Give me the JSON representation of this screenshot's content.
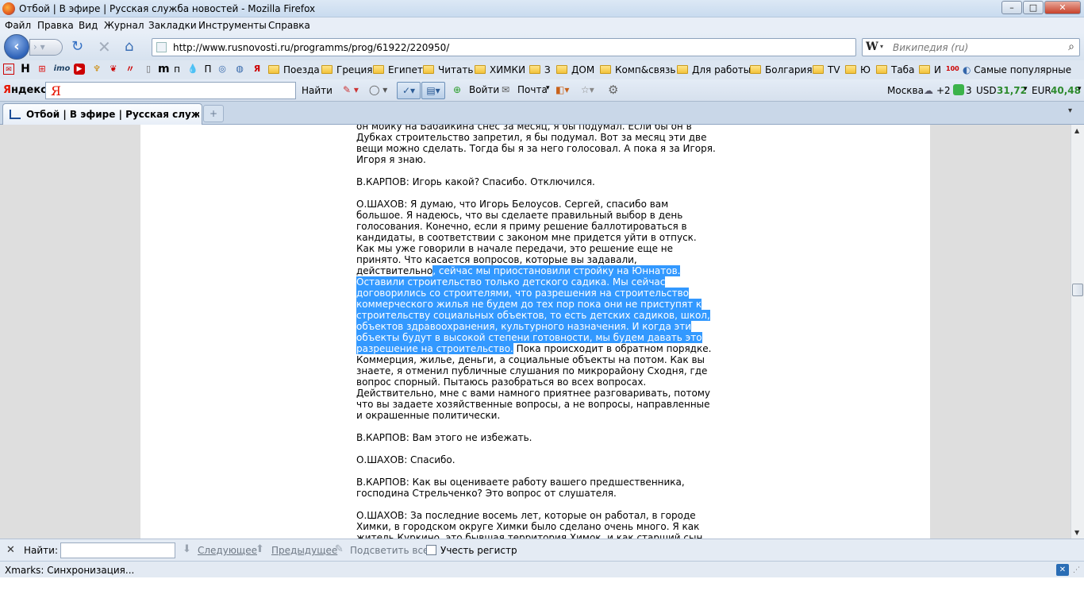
{
  "window": {
    "title": "Отбой | В эфире | Русская служба новостей - Mozilla Firefox",
    "min": "–",
    "max": "□",
    "close": "✕"
  },
  "menu": [
    "Файл",
    "Правка",
    "Вид",
    "Журнал",
    "Закладки",
    "Инструменты",
    "Справка"
  ],
  "nav": {
    "url": "http://www.rusnovosti.ru/programms/prog/61922/220950/",
    "search_placeholder": "Википедия (ru)",
    "search_engine_letter": "W"
  },
  "bookmarks": {
    "icons": [
      "H",
      "imo",
      "п",
      "П"
    ],
    "folders": [
      "Поезда",
      "Греция",
      "Египет",
      "Читать",
      "ХИМКИ",
      "З",
      "ДОМ",
      "Комп&связь",
      "Для работы",
      "Болгария",
      "TV",
      "Ю",
      "Таба",
      "И"
    ],
    "last": "Самые популярные"
  },
  "yandex": {
    "logo_red": "Я",
    "logo_rest": "ндекс",
    "input_letter": "Я",
    "find": "Найти",
    "login": "Войти",
    "mail": "Почта",
    "city": "Москва",
    "weather": "+2",
    "traffic": "3",
    "usd_label": "USD",
    "usd_value": "31,72",
    "eur_label": "EUR",
    "eur_value": "40,48"
  },
  "tab": {
    "title": "Отбой | В эфире | Русская служба н..."
  },
  "article": {
    "p1": "он мойку на Бабайкина снес за месяц, я бы подумал. Если бы он в Дубках строительство запретил, я бы подумал. Вот за месяц эти две вещи можно сделать. Тогда бы я за него голосовал. А пока я за Игоря. Игоря я знаю.",
    "p2": "В.КАРПОВ: Игорь какой? Спасибо. Отключился.",
    "p3_before": "О.ШАХОВ: Я думаю, что Игорь Белоусов. Сергей, спасибо вам большое. Я надеюсь, что вы сделаете правильный выбор в день голосования. Конечно, если я приму решение баллотироваться в кандидаты, в соответствии с законом мне придется уйти в отпуск. Как мы уже говорили в начале передачи, это решение еще не принято. Что касается вопросов, которые вы задавали, действительно",
    "p3_selected": ", сейчас мы приостановили стройку на Юннатов. Оставили строительство только детского садика. Мы сейчас договорились со строителями, что разрешения на строительство коммерческого жилья не будем до тех пор пока они не приступят к строительству социальных объектов, то есть детских садиков, школ, объектов здравоохранения, культурного назначения. И когда эти объекты будут в высокой степени готовности, мы будем давать это разрешение на строительство.",
    "p3_after": " Пока происходит в обратном порядке. Коммерция, жилье, деньги, а социальные объекты на потом. Как вы знаете, я отменил публичные слушания по микрорайону Сходня, где вопрос спорный. Пытаюсь разобраться во всех вопросах. Действительно, мне с вами намного приятнее разговаривать, потому что вы задаете хозяйственные вопросы, а не вопросы, направленные и окрашенные политически.",
    "p4": "В.КАРПОВ: Вам этого не избежать.",
    "p5": "О.ШАХОВ: Спасибо.",
    "p6": "В.КАРПОВ: Как вы оцениваете работу вашего предшественника, господина Стрельченко? Это вопрос от слушателя.",
    "p7": "О.ШАХОВ: За последние восемь лет, которые он работал, в городе Химки, в городском округе Химки было сделано очень много. Я как житель Куркино, это бывшая территория Химок, и как старший сын"
  },
  "findbar": {
    "label": "Найти:",
    "next": "Следующее",
    "prev": "Предыдущее",
    "highlight": "Подсветить все",
    "match_case": "Учесть регистр"
  },
  "status": {
    "text": "Xmarks: Синхронизация..."
  },
  "colors": {
    "selection": "#3399ff",
    "yandex_red": "#e61400",
    "currency_green": "#2e8b2e"
  }
}
